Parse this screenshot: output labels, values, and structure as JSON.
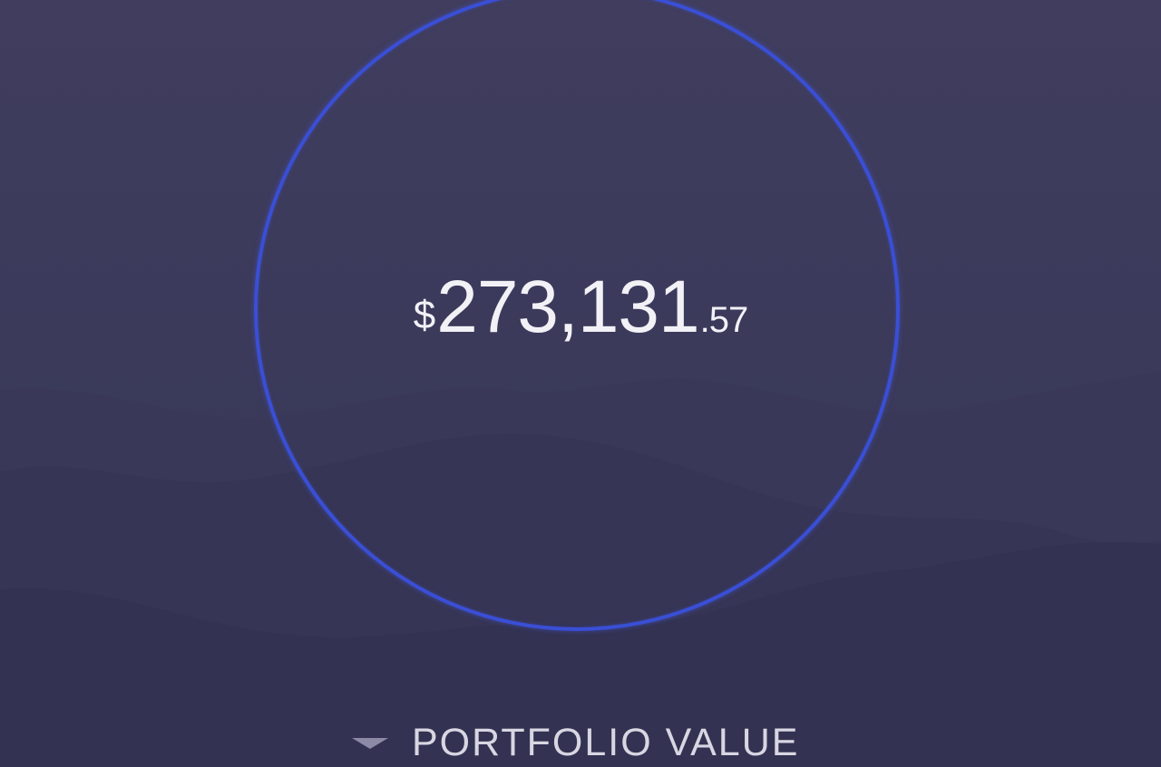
{
  "portfolio": {
    "currency_symbol": "$",
    "value_whole": "273,131",
    "value_cents": ".57",
    "label": "PORTFOLIO VALUE",
    "toggle_icon": "caret-down-icon"
  },
  "colors": {
    "background": "#3d3b5c",
    "ring": "#3a4fd6",
    "value_text": "#f2f1f6",
    "label_text": "#d8d6e2"
  }
}
